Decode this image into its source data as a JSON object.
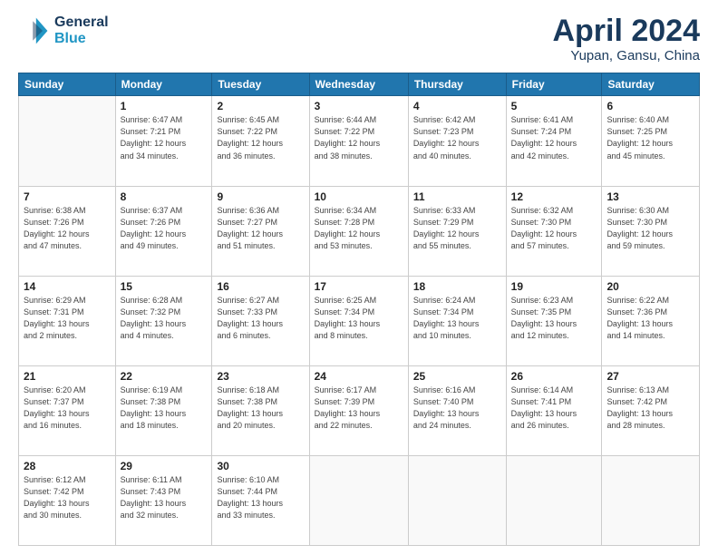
{
  "header": {
    "logo_line1": "General",
    "logo_line2": "Blue",
    "main_title": "April 2024",
    "subtitle": "Yupan, Gansu, China"
  },
  "calendar": {
    "weekdays": [
      "Sunday",
      "Monday",
      "Tuesday",
      "Wednesday",
      "Thursday",
      "Friday",
      "Saturday"
    ],
    "weeks": [
      [
        {
          "day": "",
          "info": ""
        },
        {
          "day": "1",
          "info": "Sunrise: 6:47 AM\nSunset: 7:21 PM\nDaylight: 12 hours\nand 34 minutes."
        },
        {
          "day": "2",
          "info": "Sunrise: 6:45 AM\nSunset: 7:22 PM\nDaylight: 12 hours\nand 36 minutes."
        },
        {
          "day": "3",
          "info": "Sunrise: 6:44 AM\nSunset: 7:22 PM\nDaylight: 12 hours\nand 38 minutes."
        },
        {
          "day": "4",
          "info": "Sunrise: 6:42 AM\nSunset: 7:23 PM\nDaylight: 12 hours\nand 40 minutes."
        },
        {
          "day": "5",
          "info": "Sunrise: 6:41 AM\nSunset: 7:24 PM\nDaylight: 12 hours\nand 42 minutes."
        },
        {
          "day": "6",
          "info": "Sunrise: 6:40 AM\nSunset: 7:25 PM\nDaylight: 12 hours\nand 45 minutes."
        }
      ],
      [
        {
          "day": "7",
          "info": "Sunrise: 6:38 AM\nSunset: 7:26 PM\nDaylight: 12 hours\nand 47 minutes."
        },
        {
          "day": "8",
          "info": "Sunrise: 6:37 AM\nSunset: 7:26 PM\nDaylight: 12 hours\nand 49 minutes."
        },
        {
          "day": "9",
          "info": "Sunrise: 6:36 AM\nSunset: 7:27 PM\nDaylight: 12 hours\nand 51 minutes."
        },
        {
          "day": "10",
          "info": "Sunrise: 6:34 AM\nSunset: 7:28 PM\nDaylight: 12 hours\nand 53 minutes."
        },
        {
          "day": "11",
          "info": "Sunrise: 6:33 AM\nSunset: 7:29 PM\nDaylight: 12 hours\nand 55 minutes."
        },
        {
          "day": "12",
          "info": "Sunrise: 6:32 AM\nSunset: 7:30 PM\nDaylight: 12 hours\nand 57 minutes."
        },
        {
          "day": "13",
          "info": "Sunrise: 6:30 AM\nSunset: 7:30 PM\nDaylight: 12 hours\nand 59 minutes."
        }
      ],
      [
        {
          "day": "14",
          "info": "Sunrise: 6:29 AM\nSunset: 7:31 PM\nDaylight: 13 hours\nand 2 minutes."
        },
        {
          "day": "15",
          "info": "Sunrise: 6:28 AM\nSunset: 7:32 PM\nDaylight: 13 hours\nand 4 minutes."
        },
        {
          "day": "16",
          "info": "Sunrise: 6:27 AM\nSunset: 7:33 PM\nDaylight: 13 hours\nand 6 minutes."
        },
        {
          "day": "17",
          "info": "Sunrise: 6:25 AM\nSunset: 7:34 PM\nDaylight: 13 hours\nand 8 minutes."
        },
        {
          "day": "18",
          "info": "Sunrise: 6:24 AM\nSunset: 7:34 PM\nDaylight: 13 hours\nand 10 minutes."
        },
        {
          "day": "19",
          "info": "Sunrise: 6:23 AM\nSunset: 7:35 PM\nDaylight: 13 hours\nand 12 minutes."
        },
        {
          "day": "20",
          "info": "Sunrise: 6:22 AM\nSunset: 7:36 PM\nDaylight: 13 hours\nand 14 minutes."
        }
      ],
      [
        {
          "day": "21",
          "info": "Sunrise: 6:20 AM\nSunset: 7:37 PM\nDaylight: 13 hours\nand 16 minutes."
        },
        {
          "day": "22",
          "info": "Sunrise: 6:19 AM\nSunset: 7:38 PM\nDaylight: 13 hours\nand 18 minutes."
        },
        {
          "day": "23",
          "info": "Sunrise: 6:18 AM\nSunset: 7:38 PM\nDaylight: 13 hours\nand 20 minutes."
        },
        {
          "day": "24",
          "info": "Sunrise: 6:17 AM\nSunset: 7:39 PM\nDaylight: 13 hours\nand 22 minutes."
        },
        {
          "day": "25",
          "info": "Sunrise: 6:16 AM\nSunset: 7:40 PM\nDaylight: 13 hours\nand 24 minutes."
        },
        {
          "day": "26",
          "info": "Sunrise: 6:14 AM\nSunset: 7:41 PM\nDaylight: 13 hours\nand 26 minutes."
        },
        {
          "day": "27",
          "info": "Sunrise: 6:13 AM\nSunset: 7:42 PM\nDaylight: 13 hours\nand 28 minutes."
        }
      ],
      [
        {
          "day": "28",
          "info": "Sunrise: 6:12 AM\nSunset: 7:42 PM\nDaylight: 13 hours\nand 30 minutes."
        },
        {
          "day": "29",
          "info": "Sunrise: 6:11 AM\nSunset: 7:43 PM\nDaylight: 13 hours\nand 32 minutes."
        },
        {
          "day": "30",
          "info": "Sunrise: 6:10 AM\nSunset: 7:44 PM\nDaylight: 13 hours\nand 33 minutes."
        },
        {
          "day": "",
          "info": ""
        },
        {
          "day": "",
          "info": ""
        },
        {
          "day": "",
          "info": ""
        },
        {
          "day": "",
          "info": ""
        }
      ]
    ]
  }
}
